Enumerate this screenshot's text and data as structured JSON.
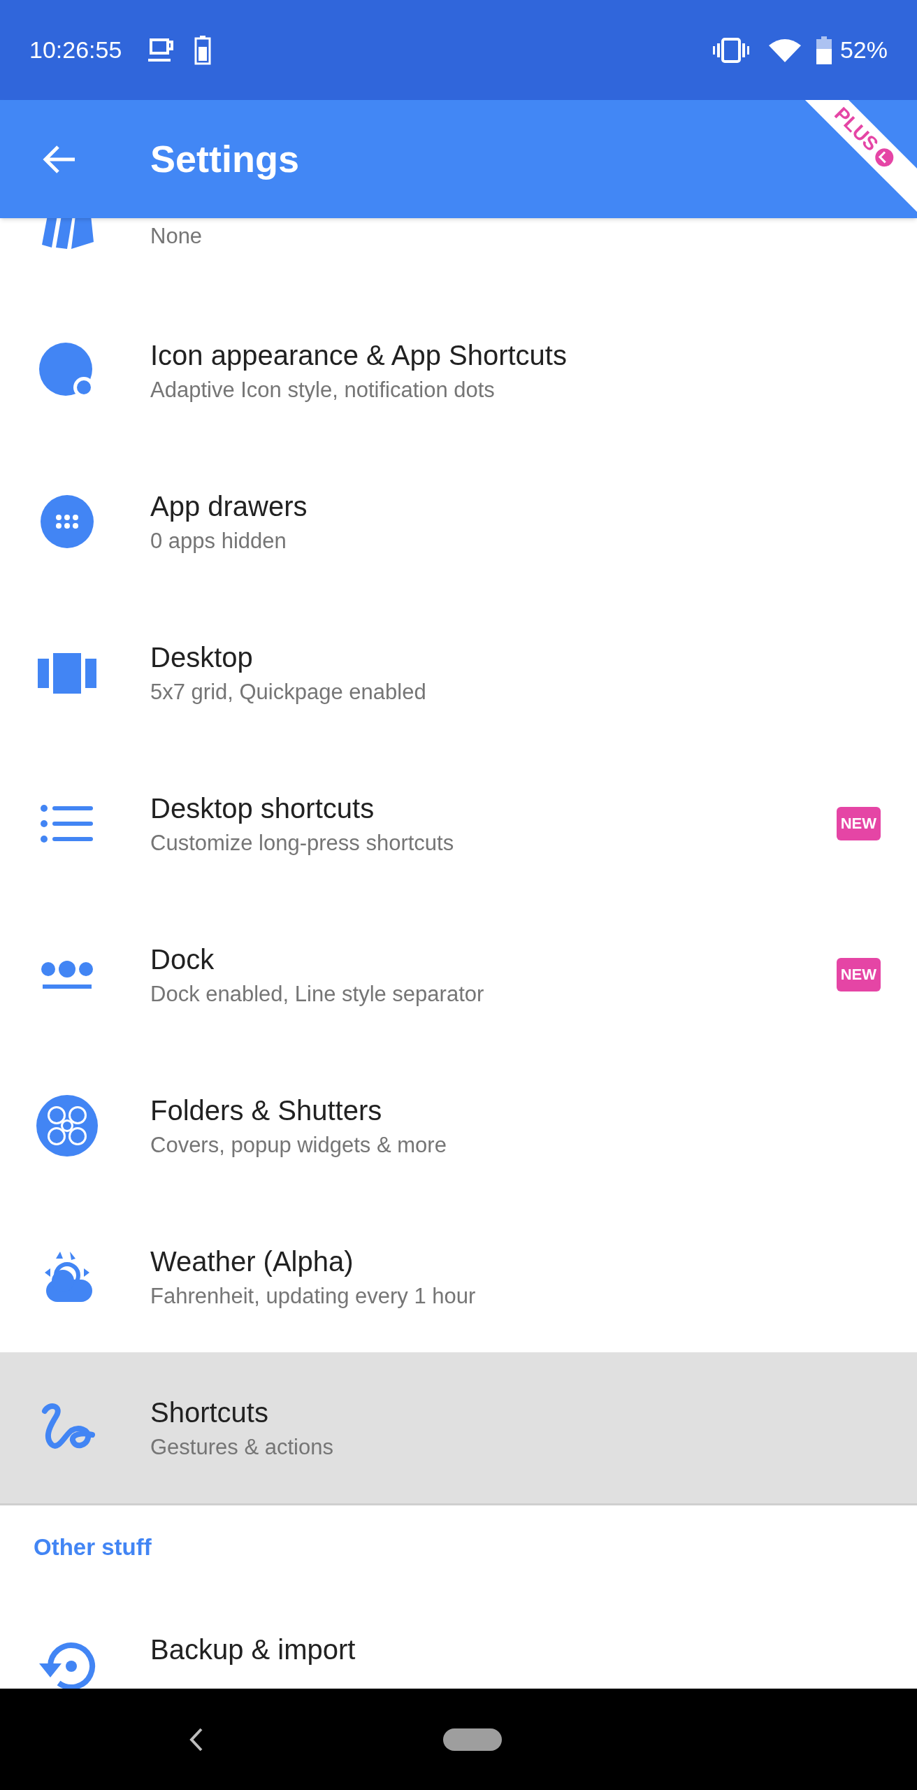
{
  "status_bar": {
    "time": "10:26:55",
    "battery": "52%"
  },
  "app_bar": {
    "title": "Settings",
    "ribbon": "PLUS"
  },
  "items": [
    {
      "kind": "cards",
      "subtitle": "None",
      "selected": false
    },
    {
      "kind": "dot-circle",
      "title": "Icon appearance & App Shortcuts",
      "subtitle": "Adaptive Icon style, notification dots",
      "selected": false
    },
    {
      "kind": "apps",
      "title": "App drawers",
      "subtitle": "0 apps hidden",
      "selected": false
    },
    {
      "kind": "pages",
      "title": "Desktop",
      "subtitle": "5x7 grid, Quickpage enabled",
      "selected": false
    },
    {
      "kind": "list",
      "title": "Desktop shortcuts",
      "subtitle": "Customize long-press shortcuts",
      "badge": "NEW",
      "selected": false
    },
    {
      "kind": "dock",
      "title": "Dock",
      "subtitle": "Dock enabled, Line style separator",
      "badge": "NEW",
      "selected": false
    },
    {
      "kind": "folder",
      "title": "Folders & Shutters",
      "subtitle": "Covers, popup widgets & more",
      "selected": false
    },
    {
      "kind": "weather",
      "title": "Weather (Alpha)",
      "subtitle": "Fahrenheit, updating every 1 hour",
      "selected": false
    },
    {
      "kind": "gesture",
      "title": "Shortcuts",
      "subtitle": "Gestures & actions",
      "selected": true
    }
  ],
  "section": {
    "title": "Other stuff",
    "items": [
      {
        "kind": "backup",
        "title": "Backup & import",
        "selected": false
      }
    ]
  }
}
